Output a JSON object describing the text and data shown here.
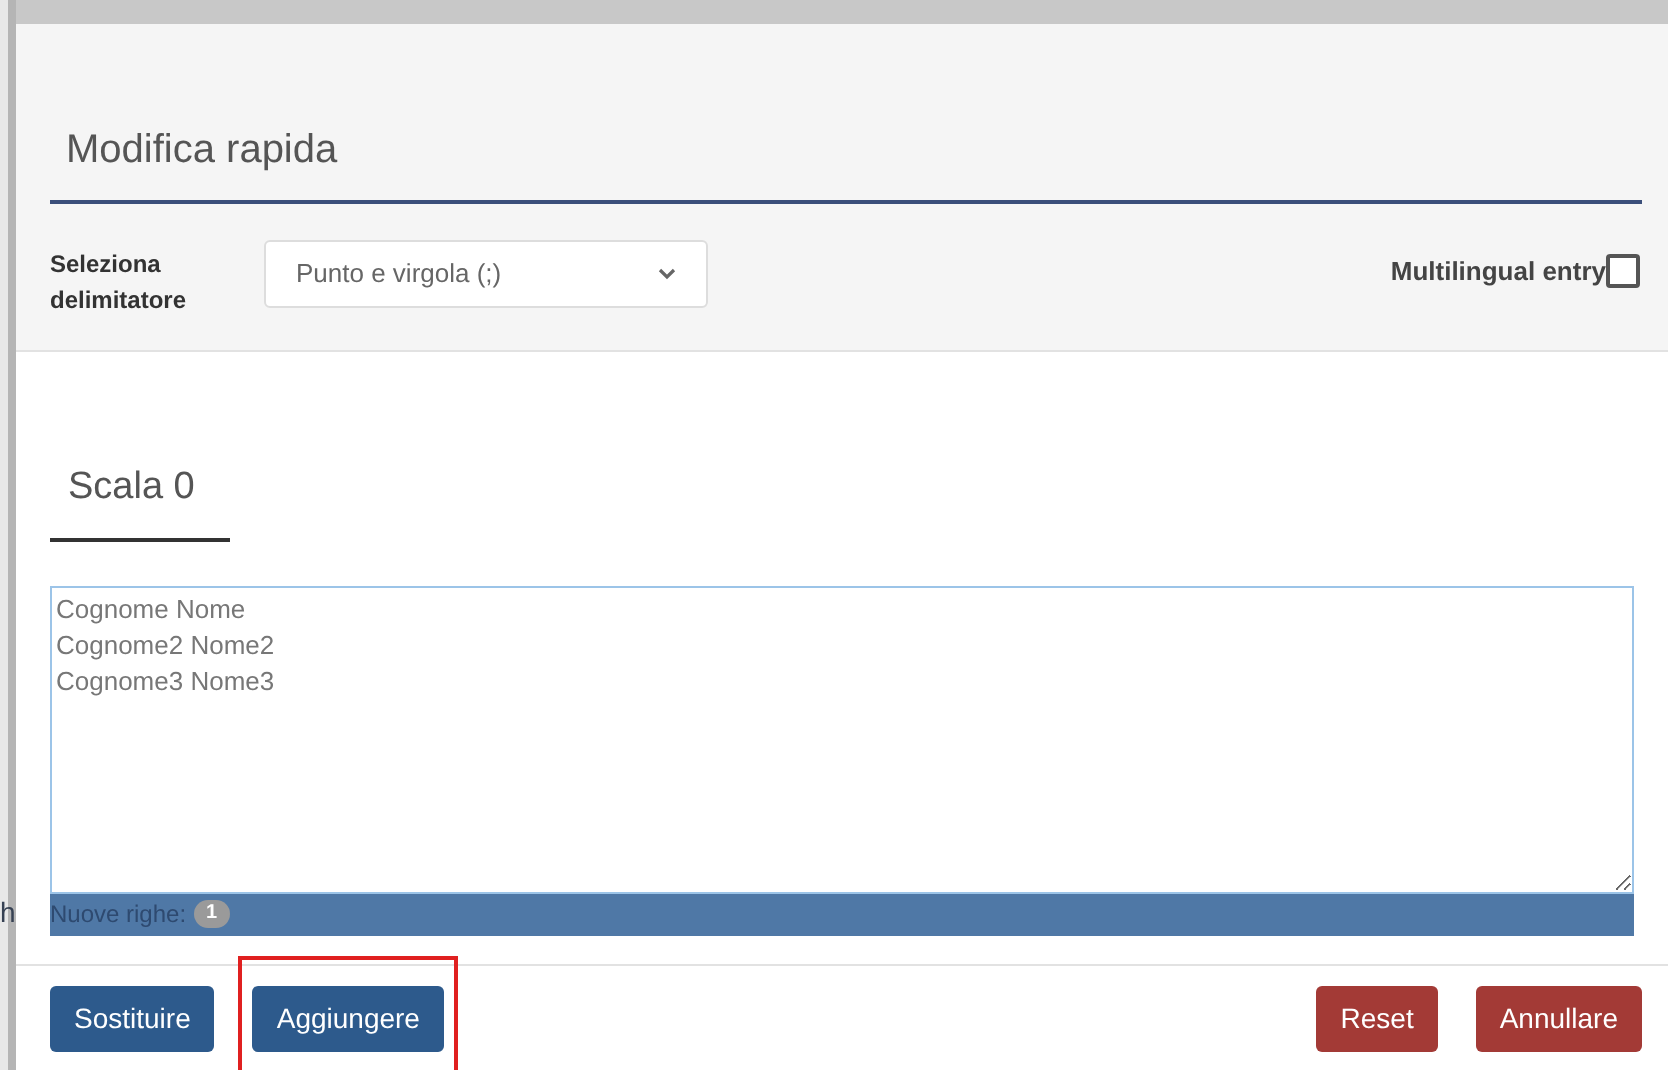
{
  "background_text": "h",
  "dialog": {
    "title": "Modifica rapida",
    "delimiter": {
      "label": "Seleziona delimitatore",
      "value": "Punto e virgola (;)"
    },
    "multilingual": {
      "label": "Multilingual entry",
      "checked": false
    },
    "section_tab": "Scala 0",
    "textarea": {
      "value": "Cognome Nome\nCognome2 Nome2\nCognome3 Nome3"
    },
    "status": {
      "label": "Nuove righe:",
      "count": "1"
    },
    "buttons": [
      {
        "label": "Sostituire",
        "kind": "primary",
        "highlighted": false
      },
      {
        "label": "Aggiungere",
        "kind": "primary",
        "highlighted": true
      },
      {
        "label": "Reset",
        "kind": "danger",
        "highlighted": false
      },
      {
        "label": "Annullare",
        "kind": "danger",
        "highlighted": false
      }
    ]
  }
}
